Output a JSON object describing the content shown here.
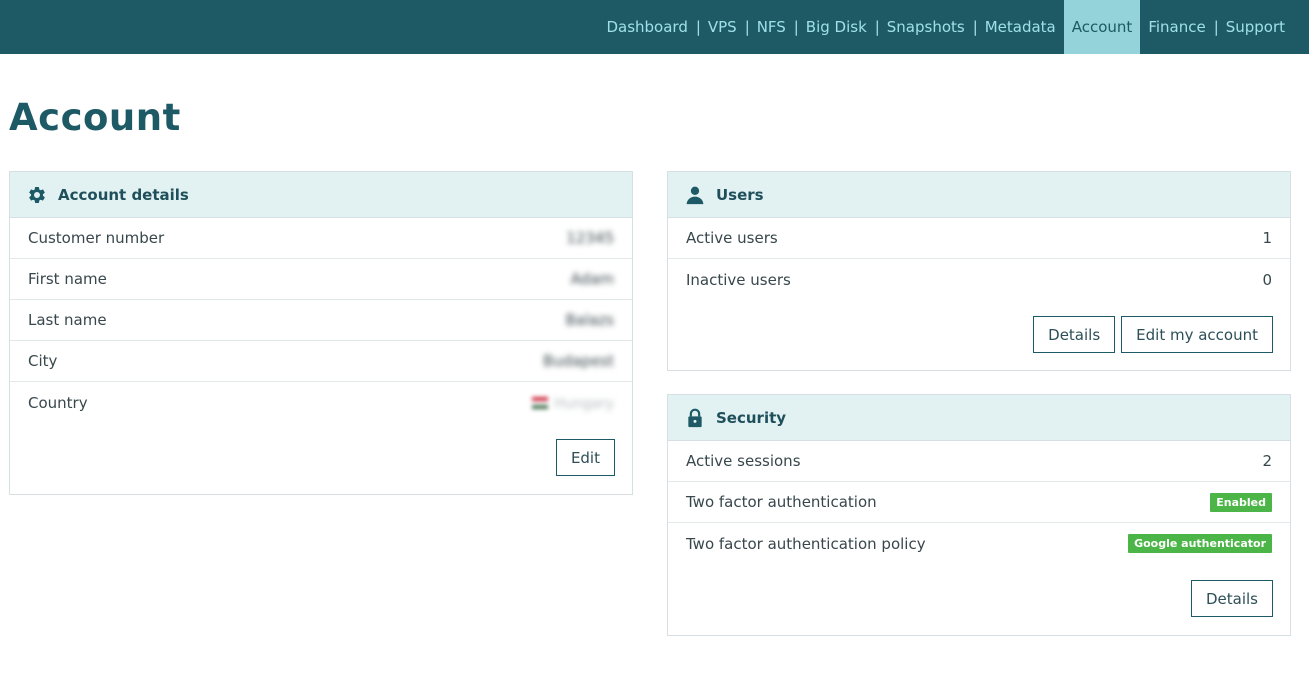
{
  "nav": {
    "items": [
      {
        "label": "Dashboard"
      },
      {
        "label": "VPS"
      },
      {
        "label": "NFS"
      },
      {
        "label": "Big Disk"
      },
      {
        "label": "Snapshots"
      },
      {
        "label": "Metadata"
      },
      {
        "label": "Account",
        "active": true
      },
      {
        "label": "Finance"
      },
      {
        "label": "Support"
      }
    ],
    "separator": "|"
  },
  "page": {
    "title": "Account"
  },
  "account_details": {
    "title": "Account details",
    "icon": "gear-icon",
    "rows": [
      {
        "label": "Customer number",
        "value": "12345"
      },
      {
        "label": "First name",
        "value": "Adam"
      },
      {
        "label": "Last name",
        "value": "Balazs"
      },
      {
        "label": "City",
        "value": "Budapest"
      },
      {
        "label": "Country",
        "value": "Hungary"
      }
    ],
    "edit_label": "Edit"
  },
  "users": {
    "title": "Users",
    "icon": "user-icon",
    "rows": [
      {
        "label": "Active users",
        "value": "1"
      },
      {
        "label": "Inactive users",
        "value": "0"
      }
    ],
    "details_label": "Details",
    "edit_account_label": "Edit my account"
  },
  "security": {
    "title": "Security",
    "icon": "lock-icon",
    "rows": [
      {
        "label": "Active sessions",
        "value": "2"
      },
      {
        "label": "Two factor authentication",
        "value": "Enabled"
      },
      {
        "label": "Two factor authentication policy",
        "value": "Google authenticator"
      }
    ],
    "details_label": "Details",
    "badge_color": "#4cb548"
  },
  "colors": {
    "nav_bg": "#1e5a66",
    "nav_text": "#9fe0e6",
    "nav_active_bg": "#94d3d9",
    "card_header_bg": "#e2f2f3"
  }
}
